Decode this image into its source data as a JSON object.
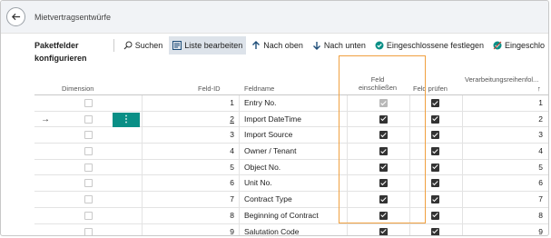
{
  "header": {
    "title": "Mietvertragsentwürfe"
  },
  "toolbar": {
    "title": "Paketfelder konfigurieren",
    "buttons": [
      {
        "label": "Suchen",
        "icon": "search-icon"
      },
      {
        "label": "Liste bearbeiten",
        "icon": "edit-list-icon"
      },
      {
        "label": "Nach oben",
        "icon": "arrow-up-icon"
      },
      {
        "label": "Nach unten",
        "icon": "arrow-down-icon"
      },
      {
        "label": "Eingeschlossene festlegen",
        "icon": "check-circle-icon"
      },
      {
        "label": "Eingeschlo",
        "icon": "check-circle-slash-icon"
      }
    ]
  },
  "grid": {
    "headers": {
      "dimension": "Dimension",
      "field_id": "Feld-ID",
      "field_name": "Feldname",
      "include_line1": "Feld",
      "include_line2": "einschließen",
      "validate": "Feld prüfen",
      "processing_order": "Verarbeitungsreihenfol...",
      "sort_arrow": "↑"
    },
    "rows": [
      {
        "id": "1",
        "name": "Entry No.",
        "include": true,
        "include_disabled": true,
        "validate": true,
        "order": "1",
        "selected": false
      },
      {
        "id": "2",
        "name": "Import DateTime",
        "include": true,
        "include_disabled": false,
        "validate": true,
        "order": "2",
        "selected": true
      },
      {
        "id": "3",
        "name": "Import Source",
        "include": true,
        "include_disabled": false,
        "validate": true,
        "order": "3",
        "selected": false
      },
      {
        "id": "4",
        "name": "Owner / Tenant",
        "include": true,
        "include_disabled": false,
        "validate": true,
        "order": "4",
        "selected": false
      },
      {
        "id": "5",
        "name": "Object No.",
        "include": true,
        "include_disabled": false,
        "validate": true,
        "order": "5",
        "selected": false
      },
      {
        "id": "6",
        "name": "Unit No.",
        "include": true,
        "include_disabled": false,
        "validate": true,
        "order": "6",
        "selected": false
      },
      {
        "id": "7",
        "name": "Contract Type",
        "include": true,
        "include_disabled": false,
        "validate": true,
        "order": "7",
        "selected": false
      },
      {
        "id": "8",
        "name": "Beginning of Contract",
        "include": true,
        "include_disabled": false,
        "validate": true,
        "order": "8",
        "selected": false
      },
      {
        "id": "9",
        "name": "Salutation Code",
        "include": true,
        "include_disabled": false,
        "validate": true,
        "order": "9",
        "selected": false
      }
    ],
    "row_menu": "⋮",
    "row_pointer": "→"
  },
  "colors": {
    "accent": "#0a8f86",
    "highlight": "#f0a040",
    "header_bg": "#f1f3f6",
    "active_btn": "#dde3ea"
  }
}
